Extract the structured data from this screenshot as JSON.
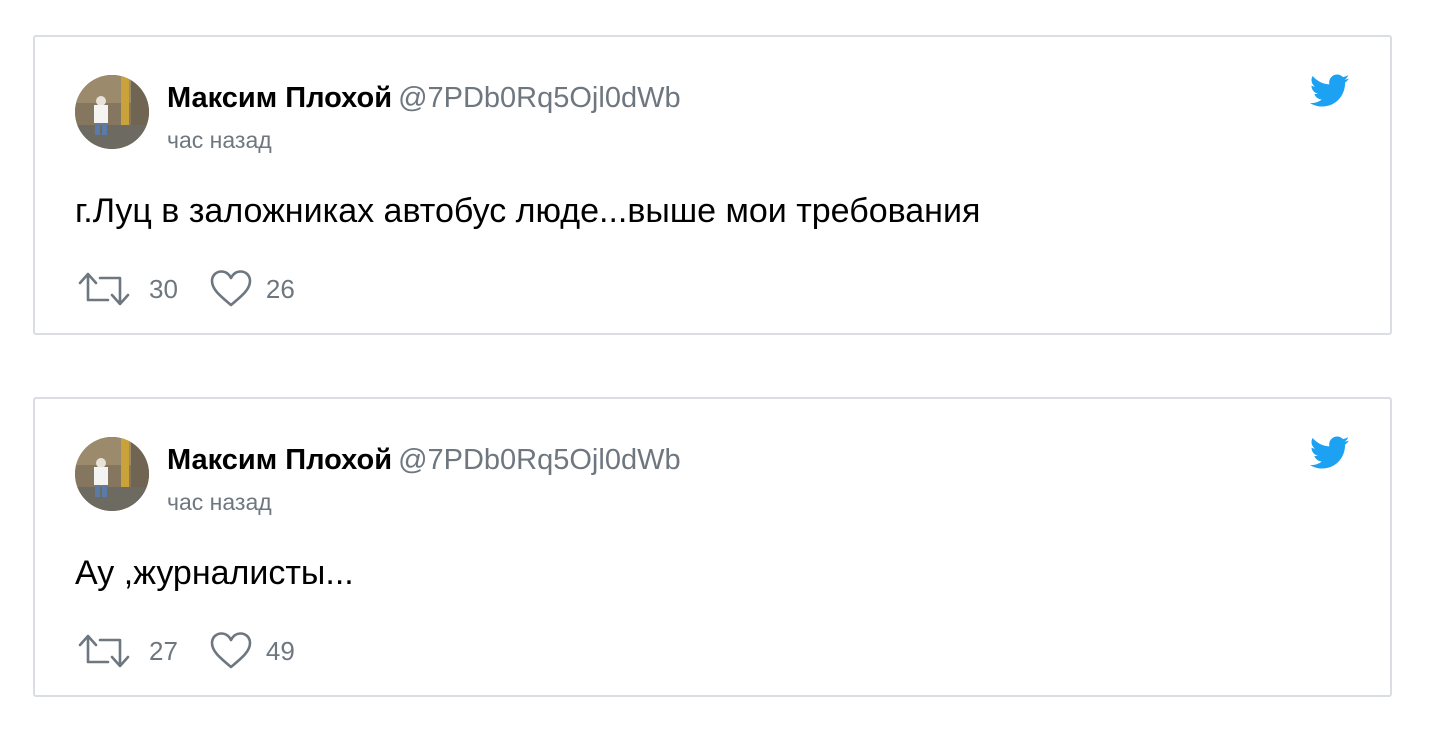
{
  "tweets": [
    {
      "author_name": "Максим Плохой",
      "author_handle": "@7PDb0Rq5Ojl0dWb",
      "timestamp": "час назад",
      "text": "г.Луц в заложниках автобус люде...выше мои требования",
      "retweets": "30",
      "likes": "26"
    },
    {
      "author_name": "Максим Плохой",
      "author_handle": "@7PDb0Rq5Ojl0dWb",
      "timestamp": "час назад",
      "text": "Ау ,журналисты...",
      "retweets": "27",
      "likes": "49"
    }
  ],
  "icons": {
    "brand": "twitter-bird-icon",
    "retweet": "retweet-icon",
    "like": "heart-icon"
  },
  "colors": {
    "twitter_blue": "#1da1f2",
    "muted_text": "#6e7780",
    "card_border": "#dadde1"
  }
}
